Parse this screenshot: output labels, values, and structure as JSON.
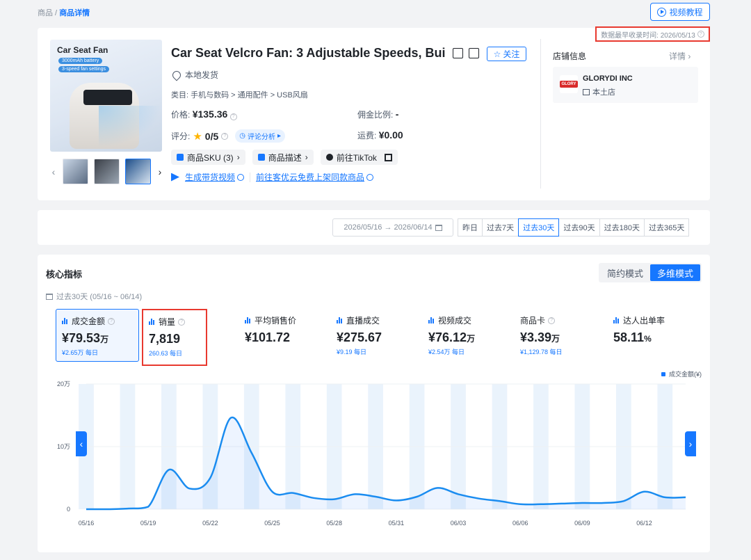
{
  "breadcrumb": {
    "parent": "商品 /",
    "current": "商品详情"
  },
  "video_tutorial": "视频教程",
  "record_time": "数据最早收录时间: 2026/05/13",
  "product": {
    "image_title": "Car Seat Fan",
    "image_pill_1": "3000mAh battery",
    "image_pill_2": "3-speed fan settings",
    "title": "Car Seat Velcro Fan: 3 Adjustable Speeds, Bui",
    "follow": "关注",
    "local_ship": "本地发货",
    "category": "类目: 手机与数码 > 通用配件 > USB风扇",
    "price_label": "价格:",
    "price": "¥135.36",
    "commission_label": "佣金比例:",
    "commission": "-",
    "rating_label": "评分:",
    "rating": "0/5",
    "review_analysis": "评论分析",
    "shipping_label": "运费:",
    "shipping": "¥0.00",
    "chips": [
      "商品SKU (3)",
      "商品描述",
      "前往TikTok"
    ],
    "link_1": "生成带货视频",
    "link_2": "前往客优云免费上架同款商品"
  },
  "store": {
    "label": "店铺信息",
    "detail": "详情",
    "name": "GLORYDI INC",
    "type": "本土店",
    "logo_text": "GLORY"
  },
  "filter": {
    "date_range": "2026/05/16 → 2026/06/14",
    "tabs": [
      "昨日",
      "过去7天",
      "过去30天",
      "过去90天",
      "过去180天",
      "过去365天"
    ],
    "active_tab": "过去30天"
  },
  "metrics": {
    "title": "核心指标",
    "modes": [
      "简约模式",
      "多维模式"
    ],
    "period": "过去30天 (05/16 ~ 06/14)",
    "items": [
      {
        "label": "成交金额",
        "value": "¥79.53",
        "unit": "万",
        "sub": "¥2.65万 每日"
      },
      {
        "label": "销量",
        "value": "7,819",
        "unit": "",
        "sub": "260.63 每日"
      },
      {
        "label": "平均销售价",
        "value": "¥101.72",
        "unit": "",
        "sub": ""
      },
      {
        "label": "直播成交",
        "value": "¥275.67",
        "unit": "",
        "sub": "¥9.19 每日"
      },
      {
        "label": "视频成交",
        "value": "¥76.12",
        "unit": "万",
        "sub": "¥2.54万 每日"
      },
      {
        "label": "商品卡",
        "value": "¥3.39",
        "unit": "万",
        "sub": "¥1,129.78 每日"
      },
      {
        "label": "达人出单率",
        "value": "58.11",
        "unit": "%",
        "sub": ""
      }
    ]
  },
  "chart_data": {
    "type": "area",
    "legend": "成交金额(¥)",
    "yticks": [
      "20万",
      "10万",
      "0"
    ],
    "ylim": [
      0,
      200000
    ],
    "xticks": [
      "05/16",
      "05/19",
      "05/22",
      "05/25",
      "05/28",
      "05/31",
      "06/03",
      "06/06",
      "06/09",
      "06/12"
    ],
    "x": [
      "05/16",
      "05/17",
      "05/18",
      "05/19",
      "05/20",
      "05/21",
      "05/22",
      "05/23",
      "05/24",
      "05/25",
      "05/26",
      "05/27",
      "05/28",
      "05/29",
      "05/30",
      "05/31",
      "06/01",
      "06/02",
      "06/03",
      "06/04",
      "06/05",
      "06/06",
      "06/07",
      "06/08",
      "06/09",
      "06/10",
      "06/11",
      "06/12",
      "06/13",
      "06/14"
    ],
    "series": [
      {
        "name": "成交金额(¥)",
        "values": [
          0,
          0,
          1000,
          4000,
          63000,
          33000,
          50000,
          146000,
          90000,
          28000,
          26000,
          18000,
          16000,
          24000,
          20000,
          14000,
          20000,
          34000,
          24000,
          17000,
          13000,
          8000,
          8000,
          9000,
          10000,
          10000,
          13000,
          28000,
          19000,
          19000
        ]
      }
    ]
  }
}
